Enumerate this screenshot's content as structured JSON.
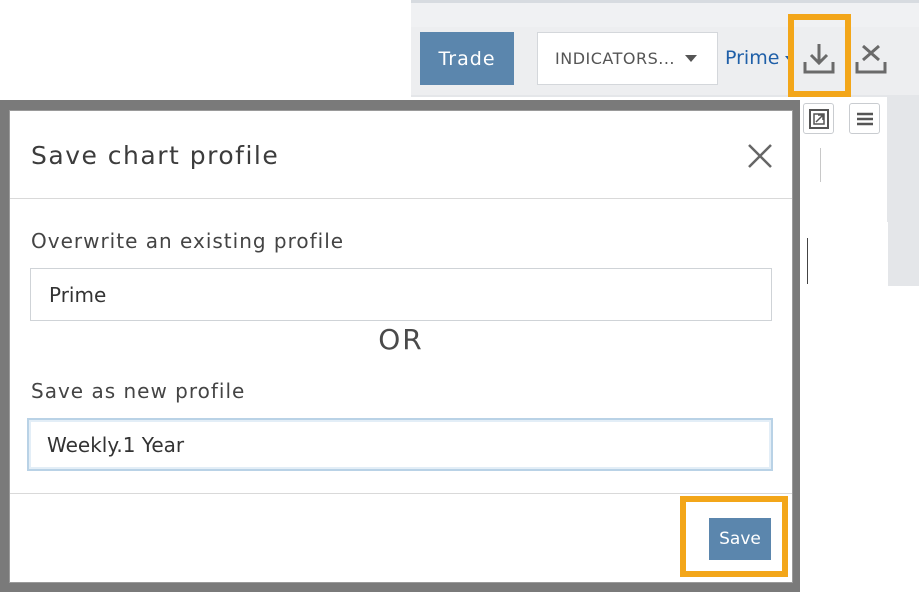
{
  "toolbar": {
    "trade_label": "Trade",
    "indicators_label": "INDICATORS...",
    "profile_label": "Prime"
  },
  "dialog": {
    "title": "Save chart profile",
    "overwrite_label": "Overwrite an existing profile",
    "overwrite_value": "Prime",
    "or_text": "OR",
    "new_label": "Save as new profile",
    "new_value": "Weekly.1 Year",
    "save_label": "Save"
  },
  "icons": {
    "download": "download-icon",
    "close_chart": "close-chart-icon",
    "popout": "popout-icon",
    "menu": "menu-icon",
    "dialog_close": "close-icon"
  },
  "colors": {
    "accent": "#5b86ad",
    "highlight": "#f3a619",
    "link": "#1f5fa8"
  }
}
